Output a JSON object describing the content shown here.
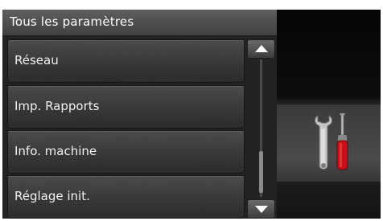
{
  "header": {
    "title": "Tous les paramètres"
  },
  "menu": {
    "items": [
      {
        "label": "Réseau"
      },
      {
        "label": "Imp. Rapports"
      },
      {
        "label": "Info. machine"
      },
      {
        "label": "Réglage init."
      }
    ]
  },
  "scrollbar": {
    "position_fraction": 0.78
  },
  "illustration": {
    "icon": "tools-icon",
    "colors": {
      "screwdriver_handle": "#c8101a",
      "wrench": "#c0c0c0"
    }
  }
}
